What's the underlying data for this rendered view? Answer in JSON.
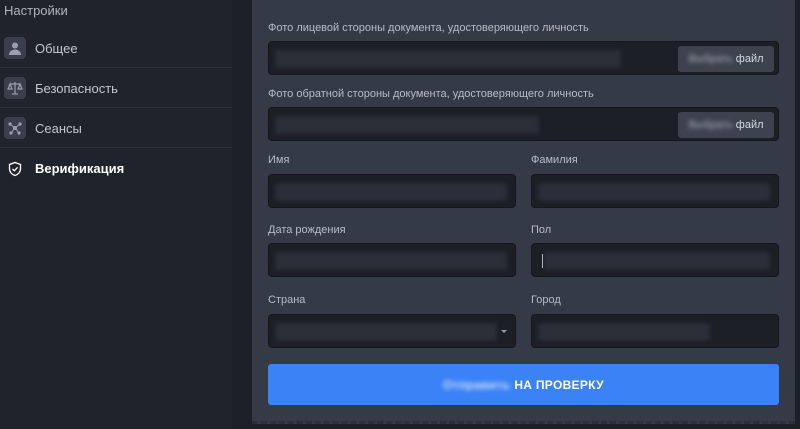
{
  "sidebar": {
    "title": "Настройки",
    "items": [
      {
        "label": "Общее",
        "icon": "user-icon"
      },
      {
        "label": "Безопасность",
        "icon": "scales-icon"
      },
      {
        "label": "Сеансы",
        "icon": "sessions-icon"
      },
      {
        "label": "Верификация",
        "icon": "shield-icon",
        "active": true
      }
    ]
  },
  "form": {
    "front_photo_label": "Фото лицевой стороны документа, удостоверяющего личность",
    "back_photo_label": "Фото обратной стороны документа, удостоверяющего личность",
    "file_button_hidden": "Выбрать",
    "file_button_suffix": "файл",
    "first_name_label": "Имя",
    "last_name_label": "Фамилия",
    "birth_date_label": "Дата рождения",
    "gender_label": "Пол",
    "country_label": "Страна",
    "city_label": "Город",
    "submit_hidden": "Отправить",
    "submit_suffix": "НА ПРОВЕРКУ"
  },
  "colors": {
    "accent": "#3b82f6",
    "panel": "#353b46",
    "field": "#1b1f26"
  }
}
